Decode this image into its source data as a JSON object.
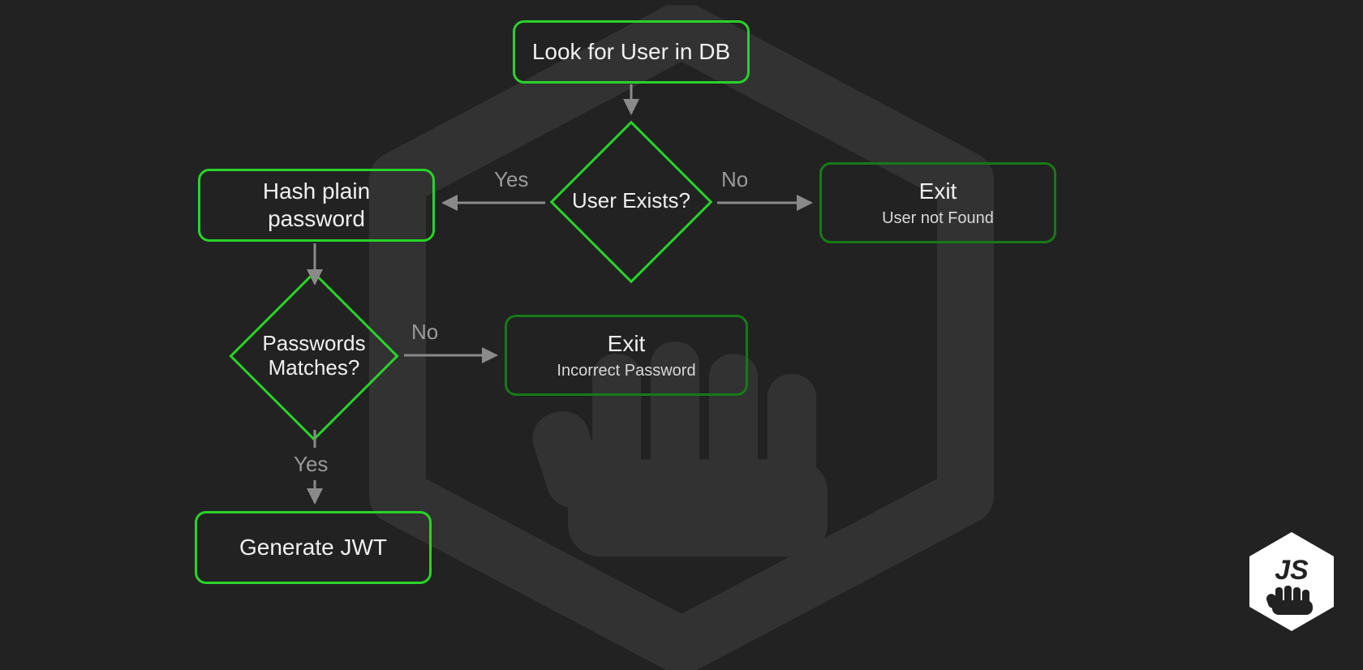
{
  "nodes": {
    "lookup": {
      "title": "Look for User in DB"
    },
    "hash": {
      "title": "Hash plain password"
    },
    "exitUser": {
      "title": "Exit",
      "sub": "User not Found"
    },
    "exitPw": {
      "title": "Exit",
      "sub": "Incorrect Password"
    },
    "jwt": {
      "title": "Generate JWT"
    }
  },
  "decisions": {
    "userExists": {
      "label": "User Exists?"
    },
    "pwMatches": {
      "label": "Passwords\nMatches?"
    }
  },
  "edges": {
    "userExists_yes": "Yes",
    "userExists_no": "No",
    "pwMatches_no": "No",
    "pwMatches_yes": "Yes"
  },
  "logo": {
    "text": "JS"
  }
}
